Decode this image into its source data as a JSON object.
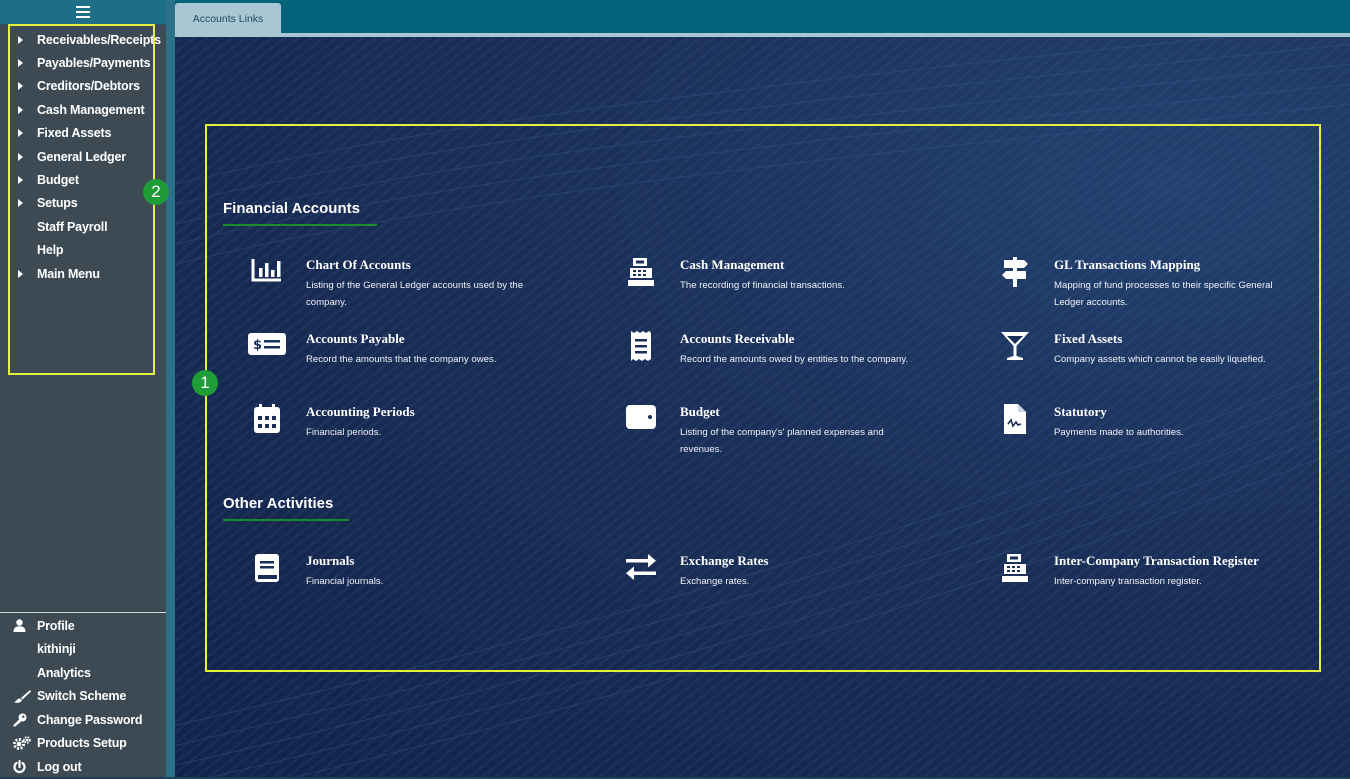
{
  "sidebar": {
    "menu_icon": "hamburger-icon",
    "items": [
      {
        "label": "Receivables/Receipts",
        "expandable": true
      },
      {
        "label": "Payables/Payments",
        "expandable": true
      },
      {
        "label": "Creditors/Debtors",
        "expandable": true
      },
      {
        "label": "Cash Management",
        "expandable": true
      },
      {
        "label": "Fixed Assets",
        "expandable": true
      },
      {
        "label": "General Ledger",
        "expandable": true
      },
      {
        "label": "Budget",
        "expandable": true
      },
      {
        "label": "Setups",
        "expandable": true
      },
      {
        "label": "Staff Payroll",
        "expandable": false
      },
      {
        "label": "Help",
        "expandable": false
      },
      {
        "label": "Main Menu",
        "expandable": true
      }
    ],
    "bottom": [
      {
        "label": "Profile",
        "icon": "user-icon"
      },
      {
        "label": "kithinji",
        "icon": ""
      },
      {
        "label": "Analytics",
        "icon": ""
      },
      {
        "label": "Switch Scheme",
        "icon": "paint-brush-icon"
      },
      {
        "label": "Change Password",
        "icon": "key-icon"
      },
      {
        "label": "Products Setup",
        "icon": "gears-icon"
      },
      {
        "label": "Log out",
        "icon": "power-icon"
      }
    ]
  },
  "tab": {
    "label": "Accounts Links"
  },
  "annotations": {
    "badge1": "1",
    "badge2": "2",
    "highlight_color": "#e4f03a",
    "badge_color": "#1f9b38"
  },
  "sections": [
    {
      "title": "Financial Accounts",
      "cards": [
        {
          "title": "Chart Of Accounts",
          "desc": "Listing of the General Ledger accounts used by the company.",
          "icon": "bar-chart-icon"
        },
        {
          "title": "Cash Management",
          "desc": "The recording of financial transactions.",
          "icon": "cash-register-icon"
        },
        {
          "title": "GL Transactions Mapping",
          "desc": "Mapping of fund processes to their specific General Ledger accounts.",
          "icon": "signpost-icon"
        },
        {
          "title": "Accounts Payable",
          "desc": "Record the amounts that the company owes.",
          "icon": "money-check-icon"
        },
        {
          "title": "Accounts Receivable",
          "desc": "Record the amounts owed by entities to the company.",
          "icon": "receipt-icon"
        },
        {
          "title": "Fixed Assets",
          "desc": "Company assets which cannot be easily liquefied.",
          "icon": "cocktail-glass-icon"
        },
        {
          "title": "Accounting Periods",
          "desc": "Financial periods.",
          "icon": "calendar-icon"
        },
        {
          "title": "Budget",
          "desc": "Listing of the company's' planned expenses and revenues.",
          "icon": "wallet-icon"
        },
        {
          "title": "Statutory",
          "desc": "Payments made to authorities.",
          "icon": "file-signature-icon"
        }
      ]
    },
    {
      "title": "Other Activities",
      "cards": [
        {
          "title": "Journals",
          "desc": "Financial journals.",
          "icon": "book-icon"
        },
        {
          "title": "Exchange Rates",
          "desc": "Exchange rates.",
          "icon": "exchange-arrows-icon"
        },
        {
          "title": "Inter-Company Transaction Register",
          "desc": "Inter-company transaction register.",
          "icon": "cash-register-icon"
        }
      ]
    }
  ]
}
